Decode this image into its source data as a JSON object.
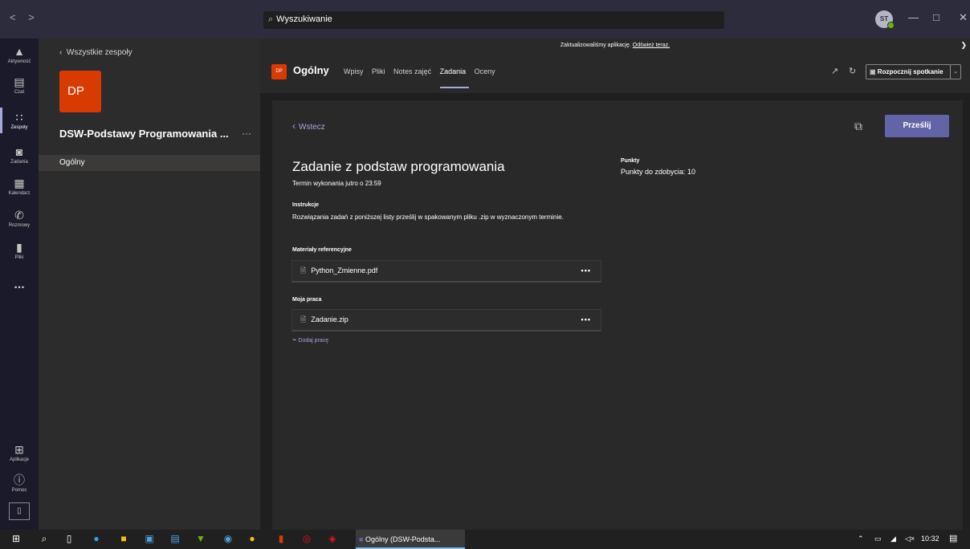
{
  "titlebar": {
    "nav_back": "<",
    "nav_forward": ">",
    "search_value": "Wyszukiwanie",
    "avatar_initials": "ST",
    "minimize": "—",
    "maximize": "□",
    "close": "✕"
  },
  "rail": [
    {
      "label": "Aktywność",
      "icon": "bell-icon"
    },
    {
      "label": "Czat",
      "icon": "chat-icon"
    },
    {
      "label": "Zespoły",
      "icon": "teams-icon"
    },
    {
      "label": "Zadania",
      "icon": "assignments-icon"
    },
    {
      "label": "Kalendarz",
      "icon": "calendar-icon"
    },
    {
      "label": "Rozmowy",
      "icon": "phone-icon"
    },
    {
      "label": "Pliki",
      "icon": "files-icon"
    }
  ],
  "rail_bottom": {
    "apps_label": "Aplikacje",
    "help_label": "Pomoc",
    "more": "..."
  },
  "team_panel": {
    "back_label": "Wszystkie zespoły",
    "team_initials": "DP",
    "team_name": "DSW-Podstawy Programowania ...",
    "team_more": "···",
    "channel": "Ogólny"
  },
  "banner": {
    "text": "Zaktualizowaliśmy aplikację.",
    "link": "Odśwież teraz."
  },
  "channel_header": {
    "avatar": "DP",
    "title": "Ogólny",
    "tabs": [
      "Wpisy",
      "Pliki",
      "Notes zajęć",
      "Zadania",
      "Oceny"
    ],
    "active_tab": "Zadania",
    "meet_label": "Rozpocznij spotkanie"
  },
  "assignment": {
    "back_label": "Wstecz",
    "submit_label": "Prześlij",
    "title": "Zadanie z podstaw programowania",
    "due": "Termin wykonania jutro o 23:59",
    "instructions_heading": "Instrukcje",
    "instructions_text": "Rozwiązania zadań z poniższej listy prześlij w spakowanym pliku .zip  w wyznaczonym terminie.",
    "reference_heading": "Materiały referencyjne",
    "reference_file": "Python_Zmienne.pdf",
    "my_work_heading": "Moja praca",
    "my_work_file": "Zadanie.zip",
    "add_work_label": "Dodaj pracę",
    "more": "•••",
    "points_heading": "Punkty",
    "points_value": "Punkty do zdobycia: 10"
  },
  "taskbar": {
    "active_task": "Ogólny (DSW-Podsta...",
    "time": "10:32"
  },
  "colors": {
    "accent": "#6264a7",
    "team_orange": "#d83b01",
    "link": "#a6a7dc",
    "presence": "#6bb700"
  }
}
